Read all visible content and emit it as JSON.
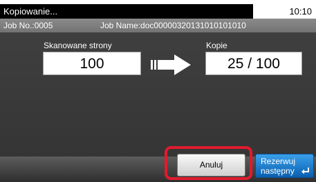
{
  "header": {
    "title": "Kopiowanie...",
    "time": "10:10"
  },
  "job": {
    "number": "Job No.:0005",
    "name": "Job Name:doc00000320131010101010"
  },
  "scanned": {
    "label": "Skanowane strony",
    "value": "100"
  },
  "copies": {
    "label": "Kopie",
    "value": "25 / 100"
  },
  "buttons": {
    "cancel": "Anuluj",
    "reserve_line1": "Rezerwuj",
    "reserve_line2": "następny"
  },
  "colors": {
    "highlight": "#e01b2e",
    "reserve_button": "#1a78cc"
  }
}
